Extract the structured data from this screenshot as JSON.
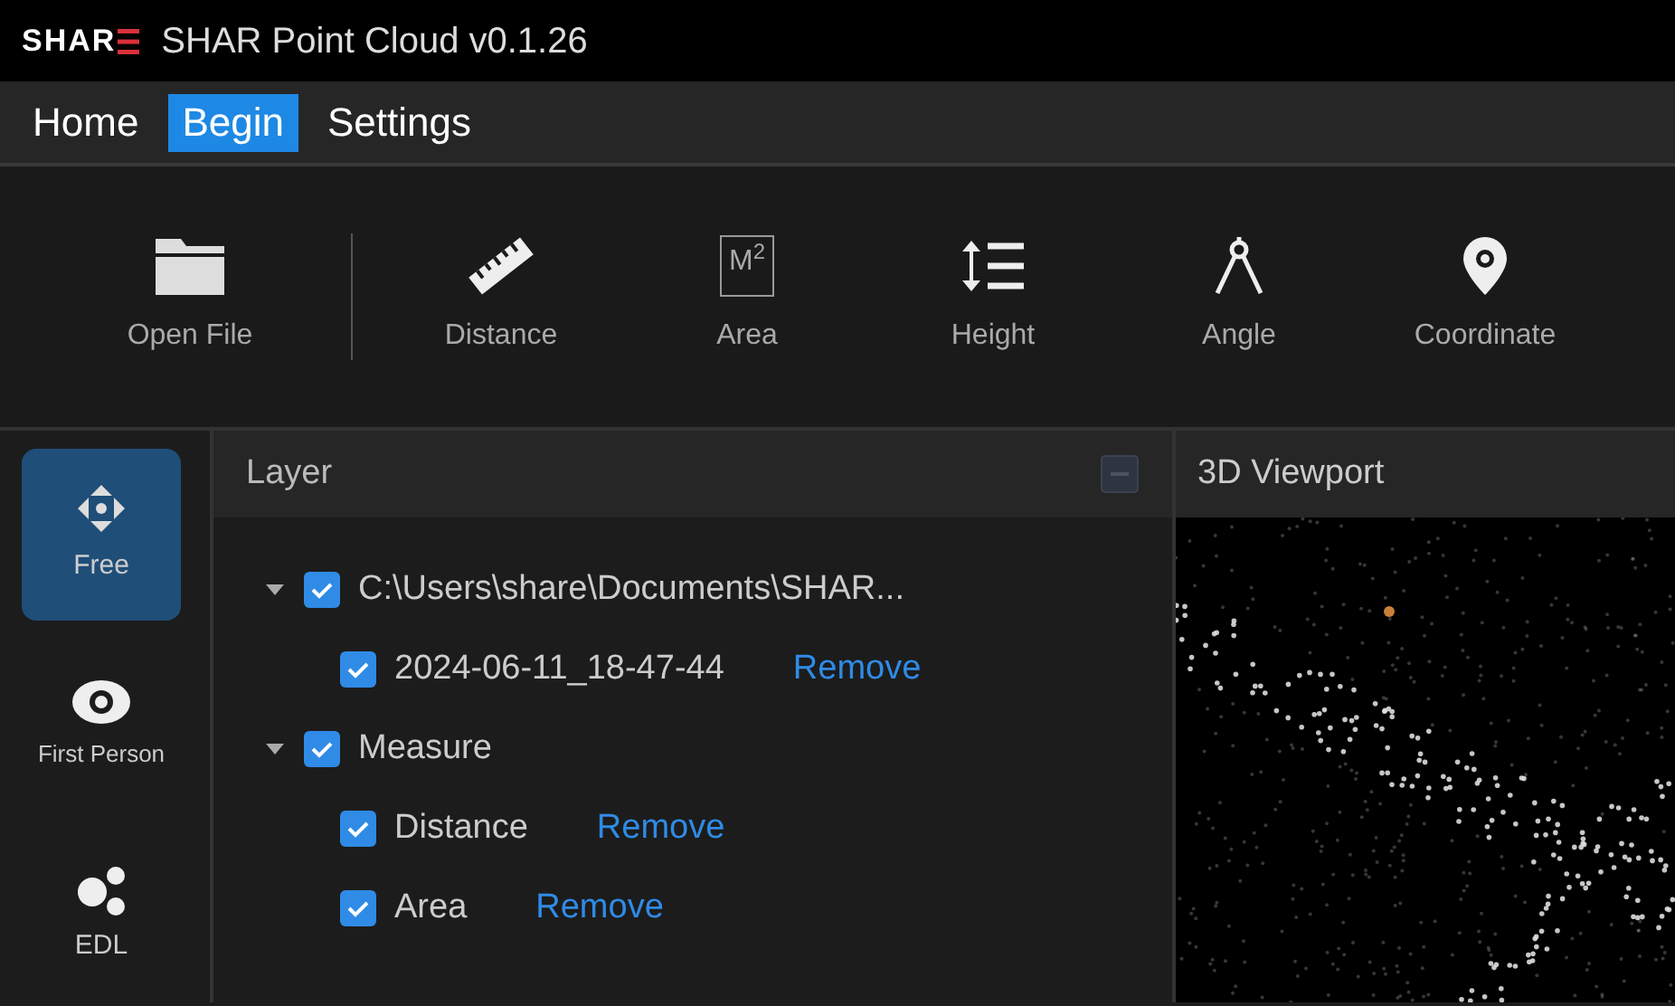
{
  "window": {
    "logo": "SHAR",
    "title": "SHAR Point Cloud v0.1.26"
  },
  "menu": [
    {
      "label": "Home",
      "selected": false
    },
    {
      "label": "Begin",
      "selected": true
    },
    {
      "label": "Settings",
      "selected": false
    }
  ],
  "toolbar": [
    {
      "kind": "folder",
      "label": "Open File"
    },
    {
      "kind": "separator"
    },
    {
      "kind": "ruler",
      "label": "Distance"
    },
    {
      "kind": "area",
      "label": "Area",
      "icon_text": "M$^{2}$"
    },
    {
      "kind": "height",
      "label": "Height"
    },
    {
      "kind": "angle",
      "label": "Angle"
    },
    {
      "kind": "pin",
      "label": "Coordinate"
    }
  ],
  "modes": [
    {
      "kind": "move",
      "label": "Free",
      "selected": true
    },
    {
      "kind": "eye",
      "label": "First Person",
      "selected": false
    },
    {
      "kind": "dots",
      "label": "EDL",
      "selected": false
    }
  ],
  "layer_panel": {
    "title": "Layer",
    "tree": [
      {
        "label": "C:\\Users\\share\\Documents\\SHAR...",
        "checked": true,
        "expanded": true,
        "children": [
          {
            "label": "2024-06-11_18-47-44",
            "checked": true,
            "action": "Remove"
          }
        ]
      },
      {
        "label": "Measure",
        "checked": true,
        "expanded": true,
        "children": [
          {
            "label": "Distance",
            "checked": true,
            "action": "Remove"
          },
          {
            "label": "Area",
            "checked": true,
            "action": "Remove"
          }
        ]
      }
    ]
  },
  "viewport": {
    "title": "3D Viewport"
  }
}
